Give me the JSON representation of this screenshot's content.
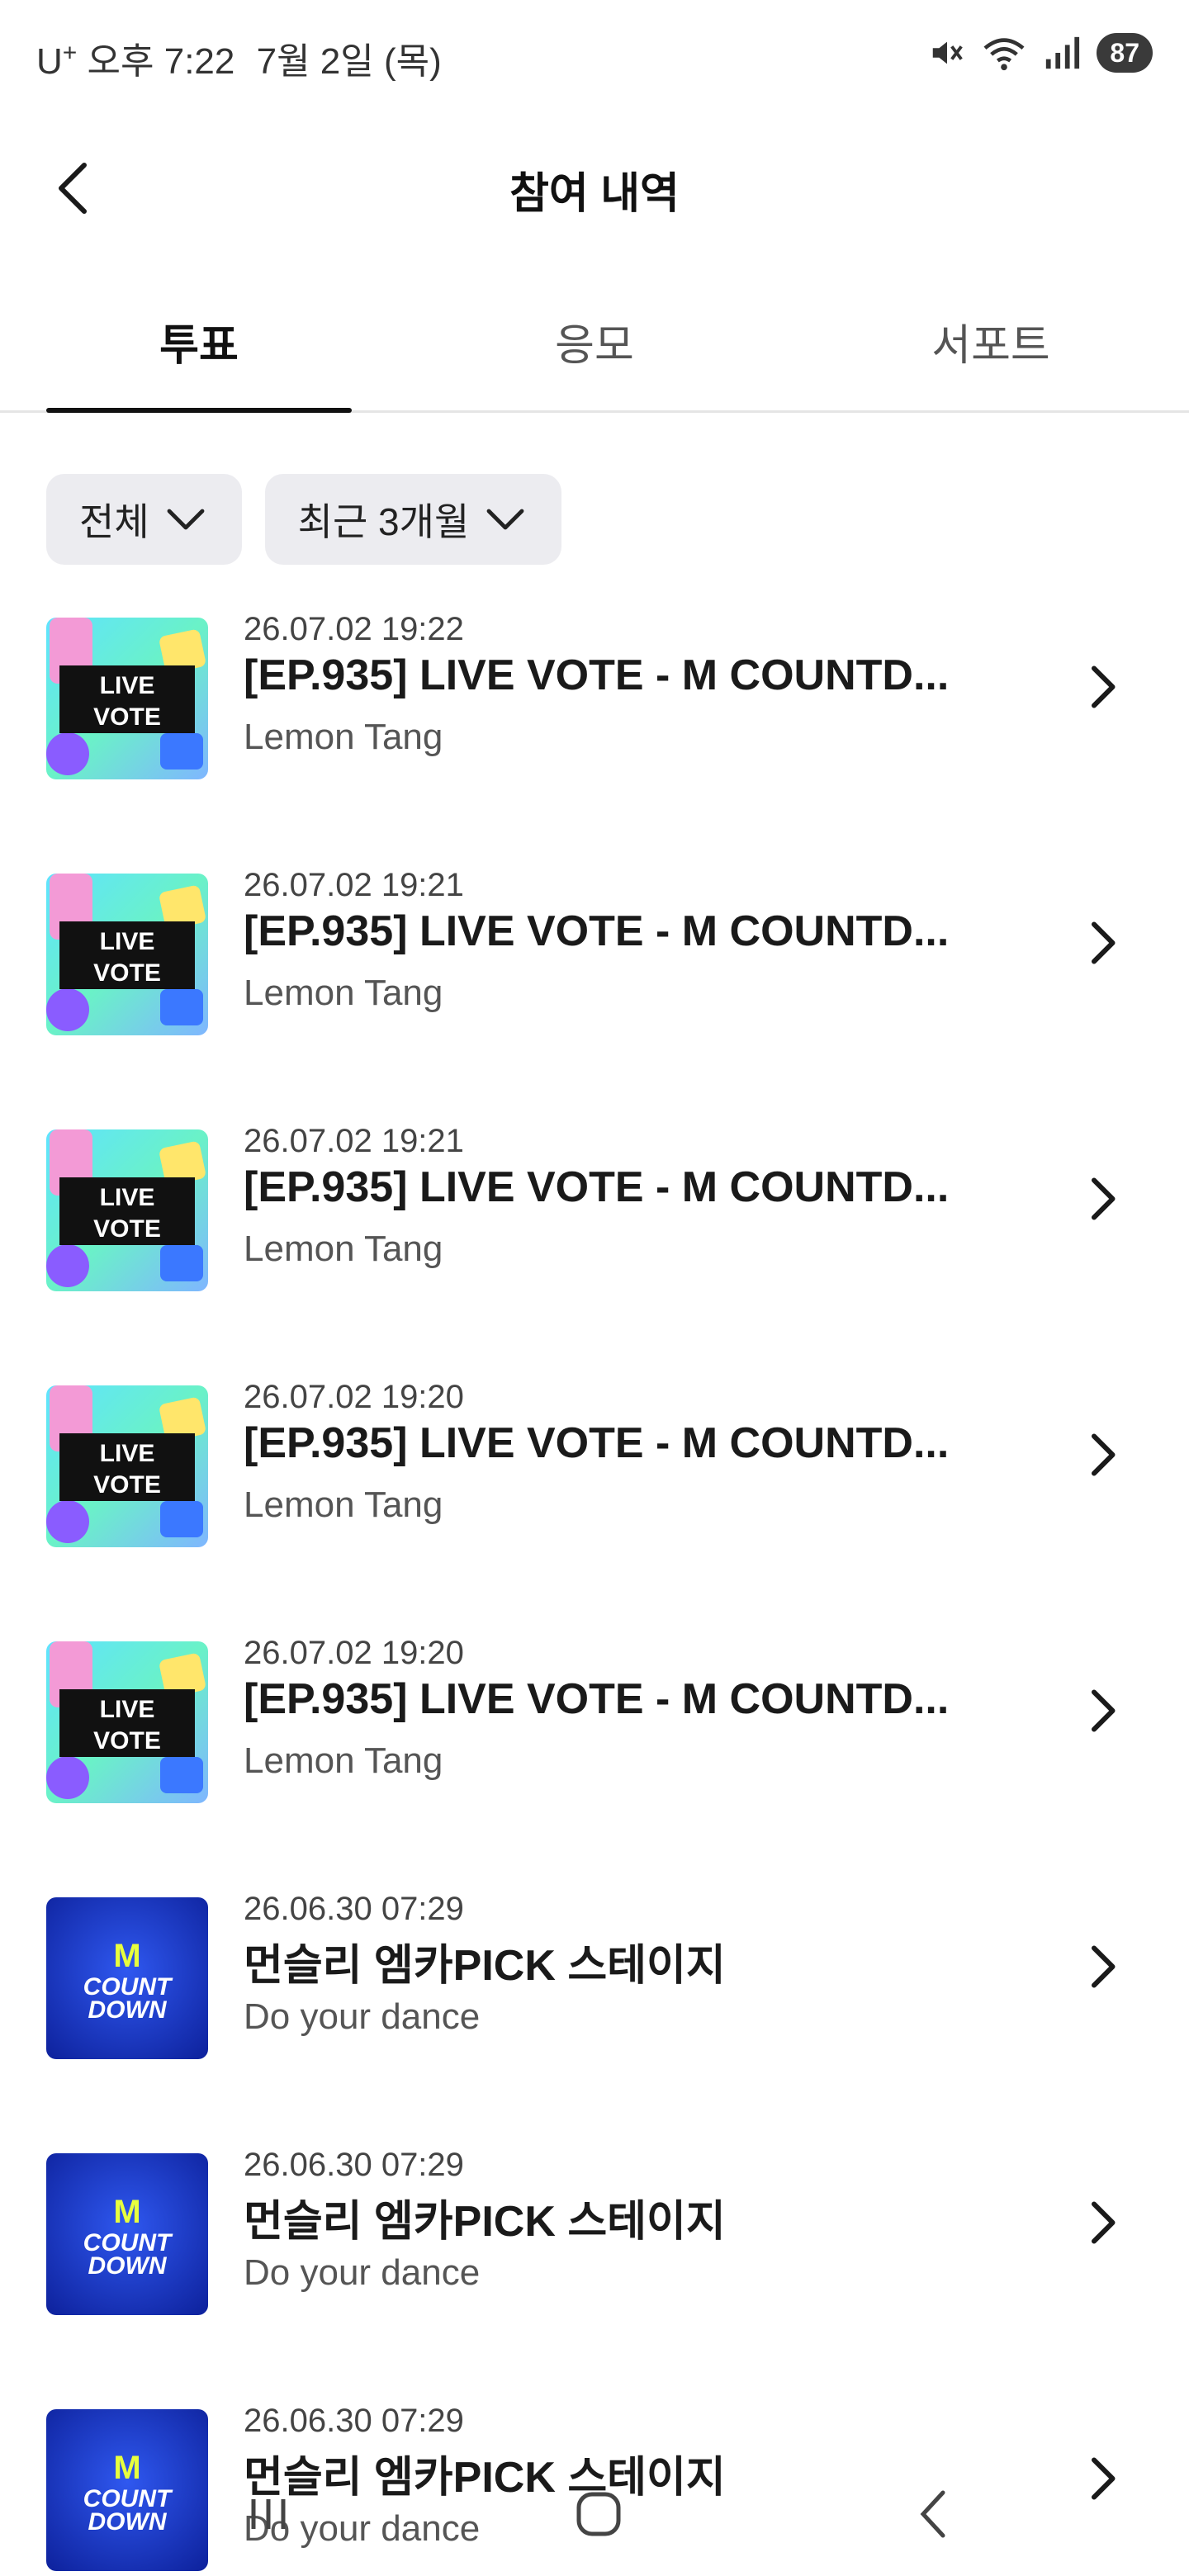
{
  "status_bar": {
    "carrier": "U",
    "carrier_sup": "+",
    "time": "오후 7:22",
    "date": "7월 2일 (목)",
    "battery": "87"
  },
  "header": {
    "title": "참여 내역"
  },
  "tabs": [
    {
      "label": "투표",
      "active": true
    },
    {
      "label": "응모",
      "active": false
    },
    {
      "label": "서포트",
      "active": false
    }
  ],
  "filters": [
    {
      "label": "전체"
    },
    {
      "label": "최근 3개월"
    }
  ],
  "items": [
    {
      "date": "26.07.02 19:22",
      "title": "[EP.935] LIVE VOTE - M COUNTD...",
      "subtitle": "Lemon Tang",
      "thumb": "live-vote",
      "thumb_text": [
        "LIVE",
        "VOTE"
      ]
    },
    {
      "date": "26.07.02 19:21",
      "title": "[EP.935] LIVE VOTE - M COUNTD...",
      "subtitle": "Lemon Tang",
      "thumb": "live-vote",
      "thumb_text": [
        "LIVE",
        "VOTE"
      ]
    },
    {
      "date": "26.07.02 19:21",
      "title": "[EP.935] LIVE VOTE - M COUNTD...",
      "subtitle": "Lemon Tang",
      "thumb": "live-vote",
      "thumb_text": [
        "LIVE",
        "VOTE"
      ]
    },
    {
      "date": "26.07.02 19:20",
      "title": "[EP.935] LIVE VOTE - M COUNTD...",
      "subtitle": "Lemon Tang",
      "thumb": "live-vote",
      "thumb_text": [
        "LIVE",
        "VOTE"
      ]
    },
    {
      "date": "26.07.02 19:20",
      "title": "[EP.935] LIVE VOTE - M COUNTD...",
      "subtitle": "Lemon Tang",
      "thumb": "live-vote",
      "thumb_text": [
        "LIVE",
        "VOTE"
      ]
    },
    {
      "date": "26.06.30 07:29",
      "title": "먼슬리 엠카PICK 스테이지",
      "subtitle": "Do your dance",
      "thumb": "m-countdown",
      "thumb_text": [
        "M",
        "COUNT",
        "DOWN"
      ]
    },
    {
      "date": "26.06.30 07:29",
      "title": "먼슬리 엠카PICK 스테이지",
      "subtitle": "Do your dance",
      "thumb": "m-countdown",
      "thumb_text": [
        "M",
        "COUNT",
        "DOWN"
      ]
    },
    {
      "date": "26.06.30 07:29",
      "title": "먼슬리 엠카PICK 스테이지",
      "subtitle": "Do your dance",
      "thumb": "m-countdown",
      "thumb_text": [
        "M",
        "COUNT",
        "DOWN"
      ]
    }
  ],
  "icons": {
    "back": "back-arrow-icon",
    "chevron_down": "chevron-down-icon",
    "chevron_right": "chevron-right-icon",
    "mute": "mute-icon",
    "wifi": "wifi-icon",
    "signal": "signal-icon",
    "nav_recent": "recent-apps-icon",
    "nav_home": "home-icon",
    "nav_back": "nav-back-icon"
  },
  "colors": {
    "text_primary": "#1a1a1a",
    "filter_bg": "#ececf0",
    "tab_indicator": "#111111",
    "battery_bg": "#3a3a3a"
  }
}
